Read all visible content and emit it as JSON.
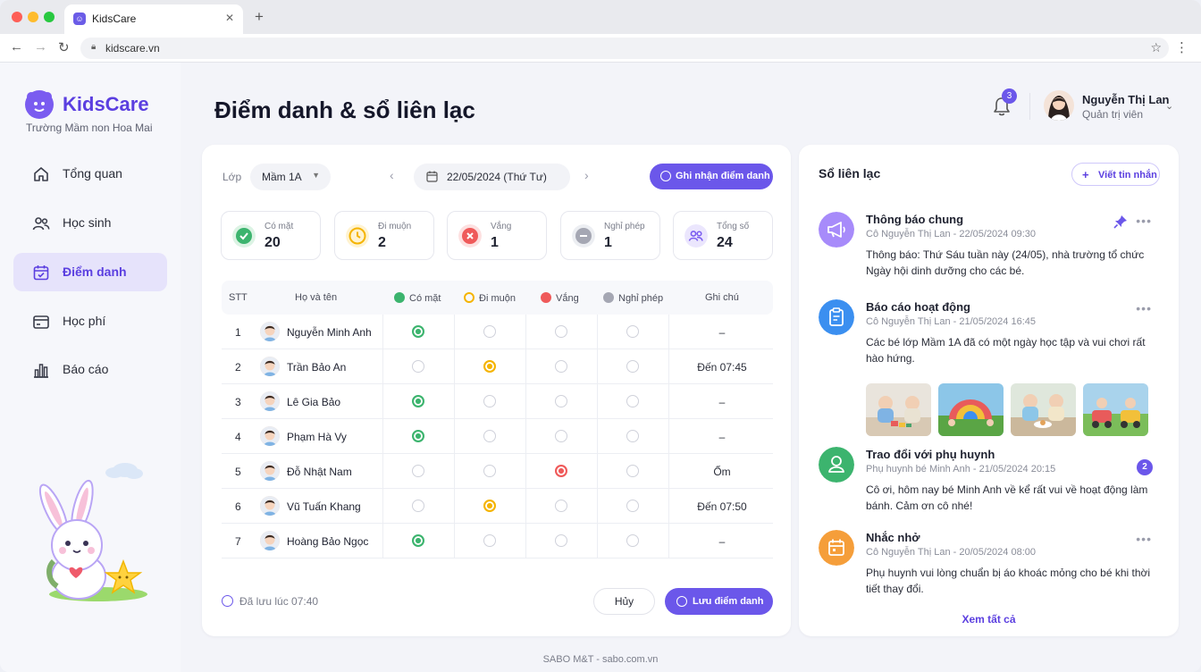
{
  "browser": {
    "tab_title": "KidsCare",
    "url": "kidscare.vn",
    "new_tab": "+",
    "close": "✕"
  },
  "sidebar": {
    "brand": "KidsCare",
    "school": "Trường Mầm non Hoa Mai",
    "items": [
      {
        "label": "Tổng quan",
        "icon": "home-icon"
      },
      {
        "label": "Học sinh",
        "icon": "users-icon"
      },
      {
        "label": "Điểm danh",
        "icon": "calendar-check-icon",
        "active": true
      },
      {
        "label": "Học phí",
        "icon": "wallet-icon"
      },
      {
        "label": "Báo cáo",
        "icon": "bar-chart-icon"
      }
    ]
  },
  "header": {
    "title": "Điểm danh & sổ liên lạc",
    "notification_count": "3",
    "user_name": "Nguyễn Thị Lan",
    "user_role": "Quản trị viên"
  },
  "attendance": {
    "class_label": "Lớp",
    "class_value": "Mầm 1A",
    "date": "22/05/2024 (Thứ Tư)",
    "record_button": "Ghi nhận điểm danh",
    "stats": [
      {
        "label": "Có mặt",
        "value": "20",
        "color": "#3cb46e"
      },
      {
        "label": "Đi muộn",
        "value": "2",
        "color": "#f5b400"
      },
      {
        "label": "Vắng",
        "value": "1",
        "color": "#ef5a5a"
      },
      {
        "label": "Nghỉ phép",
        "value": "1",
        "color": "#9a9cab"
      },
      {
        "label": "Tổng số",
        "value": "24",
        "color": "#7a5cf0"
      }
    ],
    "columns": {
      "stt": "STT",
      "name": "Họ và tên",
      "present": "Có mặt",
      "late": "Đi muộn",
      "absent": "Vắng",
      "leave": "Nghỉ phép",
      "note": "Ghi chú"
    },
    "status_colors": {
      "present": "#3cb46e",
      "late": "#f5b400",
      "absent": "#ef5a5a",
      "leave": "#9a9cab"
    },
    "rows": [
      {
        "stt": "1",
        "name": "Nguyễn Minh Anh",
        "status": "present",
        "note": "–"
      },
      {
        "stt": "2",
        "name": "Trần Bảo An",
        "status": "late",
        "note": "Đến 07:45"
      },
      {
        "stt": "3",
        "name": "Lê Gia Bảo",
        "status": "present",
        "note": "–"
      },
      {
        "stt": "4",
        "name": "Phạm Hà Vy",
        "status": "present",
        "note": "–"
      },
      {
        "stt": "5",
        "name": "Đỗ Nhật Nam",
        "status": "absent",
        "note": "Ốm"
      },
      {
        "stt": "6",
        "name": "Vũ Tuấn Khang",
        "status": "late",
        "note": "Đến 07:50"
      },
      {
        "stt": "7",
        "name": "Hoàng Bảo Ngọc",
        "status": "present",
        "note": "–"
      }
    ],
    "saved_text": "Đã lưu lúc 07:40",
    "cancel_button": "Hủy",
    "save_button": "Lưu điểm danh"
  },
  "notes": {
    "title": "Sổ liên lạc",
    "compose_button": "Viết tin nhắn",
    "items": [
      {
        "title": "Thông báo chung",
        "meta": "Cô Nguyễn Thị Lan - 22/05/2024 09:30",
        "body": "Thông báo: Thứ Sáu tuần này (24/05), nhà trường tổ chức Ngày hội dinh dưỡng cho các bé.",
        "color": "#a78bfa",
        "icon": "megaphone-icon"
      },
      {
        "title": "Báo cáo hoạt động",
        "meta": "Cô Nguyễn Thị Lan - 21/05/2024 16:45",
        "body": "Các bé lớp Mầm 1A đã có một ngày học tập và vui chơi rất hào hứng.",
        "color": "#3b8ff0",
        "icon": "clipboard-icon"
      },
      {
        "title": "Trao đổi với phụ huynh",
        "meta": "Phụ huynh bé Minh Anh - 21/05/2024 20:15",
        "body": "Cô ơi, hôm nay bé Minh Anh về kể rất vui về hoạt động làm bánh. Cảm ơn cô nhé!",
        "color": "#3cb46e",
        "icon": "user-icon",
        "unread": "2"
      },
      {
        "title": "Nhắc nhở",
        "meta": "Cô Nguyễn Thị Lan - 20/05/2024 08:00",
        "body": "Phụ huynh vui lòng chuẩn bị áo khoác mỏng cho bé khi thời tiết thay đổi.",
        "color": "#f59e3a",
        "icon": "calendar-icon"
      }
    ],
    "more": "•••",
    "see_all": "Xem tất cả"
  },
  "footer": "SABO M&T - sabo.com.vn"
}
